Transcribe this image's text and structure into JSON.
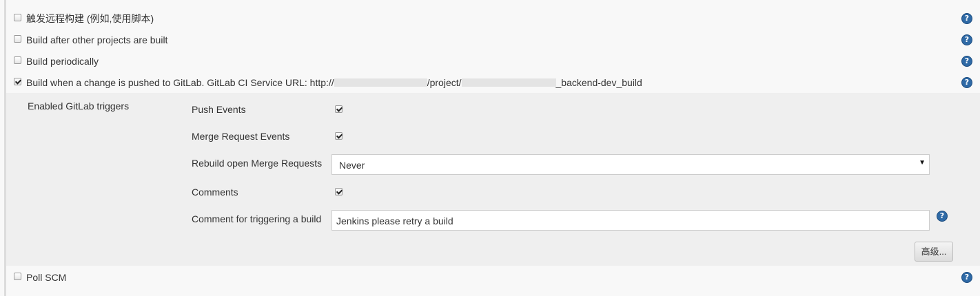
{
  "triggers": [
    {
      "label": "触发远程构建 (例如,使用脚本)",
      "checked": false
    },
    {
      "label": "Build after other projects are built",
      "checked": false
    },
    {
      "label": "Build periodically",
      "checked": false
    },
    {
      "label": "Build when a change is pushed to GitLab. GitLab CI Service URL: http://",
      "label_mid": "/project/",
      "label_end": "_backend-dev_build",
      "checked": true
    },
    {
      "label": "Poll SCM",
      "checked": false
    }
  ],
  "gitlab": {
    "section_label": "Enabled GitLab triggers",
    "push_events": {
      "label": "Push Events",
      "checked": true
    },
    "merge_request_events": {
      "label": "Merge Request Events",
      "checked": true
    },
    "rebuild_open_mr": {
      "label": "Rebuild open Merge Requests",
      "value": "Never"
    },
    "comments": {
      "label": "Comments",
      "checked": true
    },
    "comment_trigger": {
      "label": "Comment for triggering a build",
      "value": "Jenkins please retry a build"
    },
    "advanced_button": "高级..."
  },
  "icons": {
    "help": "help-icon",
    "dropdown": "chevron-down-icon"
  },
  "colors": {
    "help_icon": "#2f6aa6",
    "panel_bg": "#efefef",
    "page_bg": "#f8f8f8"
  }
}
